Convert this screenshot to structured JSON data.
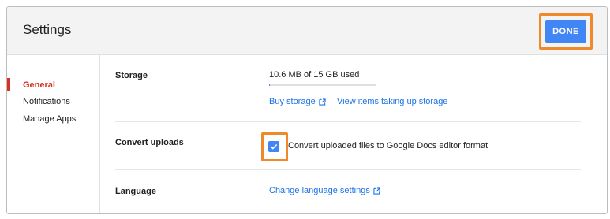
{
  "header": {
    "title": "Settings",
    "done_label": "DONE"
  },
  "sidebar": {
    "items": [
      {
        "label": "General",
        "active": true
      },
      {
        "label": "Notifications",
        "active": false
      },
      {
        "label": "Manage Apps",
        "active": false
      }
    ]
  },
  "storage": {
    "label": "Storage",
    "usage_text": "10.6 MB of 15 GB used",
    "usage_fraction": 0.0007,
    "buy_link": "Buy storage",
    "view_link": "View items taking up storage"
  },
  "convert": {
    "label": "Convert uploads",
    "checkbox_label": "Convert uploaded files to Google Docs editor format",
    "checked": true
  },
  "language": {
    "label": "Language",
    "link": "Change language settings"
  },
  "colors": {
    "accent": "#4285f4",
    "link": "#1a73e8",
    "active_nav": "#d93025",
    "highlight": "#f0892b"
  }
}
